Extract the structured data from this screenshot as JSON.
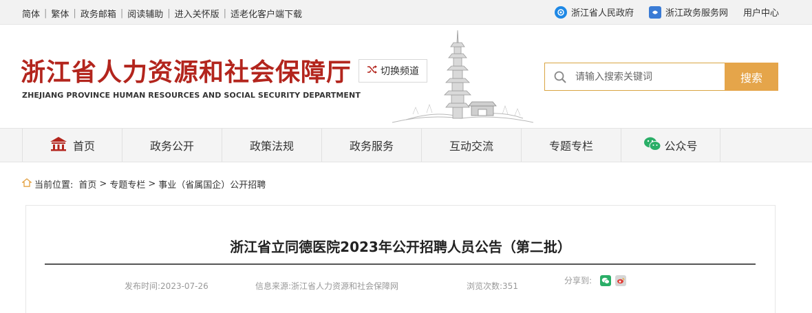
{
  "topbar": {
    "links": [
      "简体",
      "繁体",
      "政务邮箱",
      "阅读辅助",
      "进入关怀版",
      "适老化客户端下载"
    ],
    "ext_links": [
      "浙江省人民政府",
      "浙江政务服务网"
    ],
    "user_center": "用户中心"
  },
  "header": {
    "title_cn": "浙江省人力资源和社会保障厅",
    "title_en": "ZHEJIANG PROVINCE HUMAN RESOURCES AND SOCIAL SECURITY DEPARTMENT",
    "switch_channel": "切换频道",
    "search_placeholder": "请输入搜索关键词",
    "search_button": "搜索"
  },
  "nav": {
    "items": [
      "首页",
      "政务公开",
      "政策法规",
      "政务服务",
      "互动交流",
      "专题专栏",
      "公众号"
    ]
  },
  "breadcrumb": {
    "prefix": "当前位置:",
    "items": [
      "首页",
      "专题专栏",
      "事业（省属国企）公开招聘"
    ],
    "separator": ">"
  },
  "article": {
    "title": "浙江省立同德医院2023年公开招聘人员公告（第二批）",
    "publish_time": "发布时间:2023-07-26",
    "source": "信息来源:浙江省人力资源和社会保障网",
    "views": "浏览次数:351",
    "share_label": "分享到:"
  },
  "colors": {
    "brand_red": "#b3251d",
    "search_accent": "#e5a54a",
    "wechat_green": "#2aae67"
  }
}
